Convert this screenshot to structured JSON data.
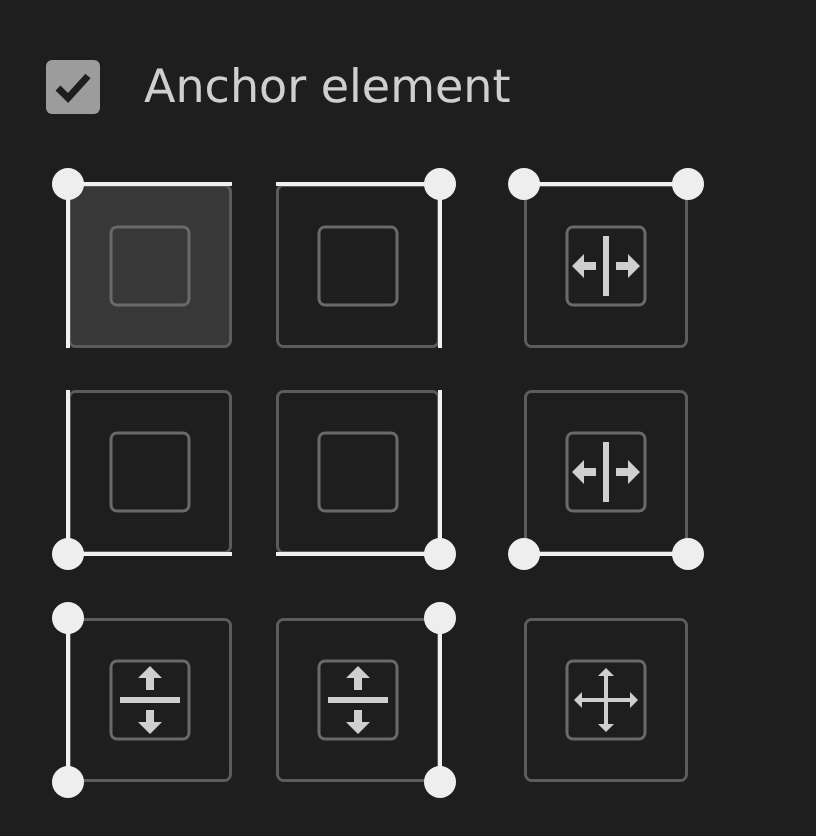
{
  "anchor_element": {
    "label": "Anchor element",
    "checked": true
  },
  "anchors": [
    {
      "kind": "top-left",
      "selected": true
    },
    {
      "kind": "top-right",
      "selected": false
    },
    {
      "kind": "top-stretch",
      "selected": false
    },
    {
      "kind": "bottom-left",
      "selected": false
    },
    {
      "kind": "bottom-right",
      "selected": false
    },
    {
      "kind": "bottom-stretch",
      "selected": false
    },
    {
      "kind": "left-stretch",
      "selected": false
    },
    {
      "kind": "right-stretch",
      "selected": false
    },
    {
      "kind": "stretch-both",
      "selected": false
    }
  ]
}
